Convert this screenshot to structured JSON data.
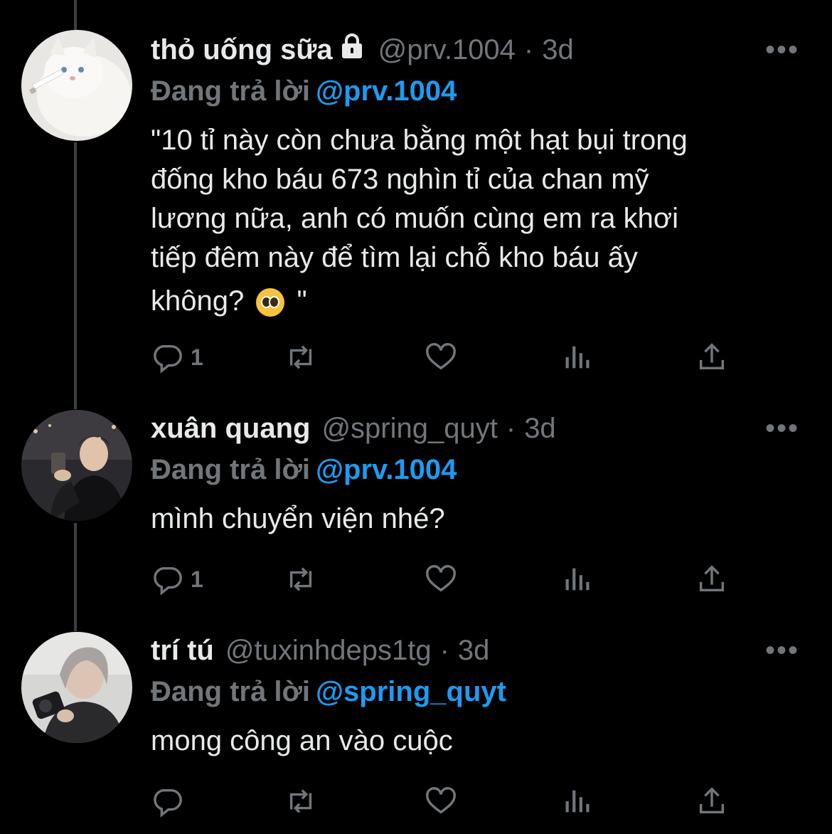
{
  "tweets": [
    {
      "name": "thỏ uống sữa",
      "handle": "@prv.1004",
      "dot": "·",
      "time": "3d",
      "more": "•••",
      "replying_label": "Đang trả lời",
      "replying_to": "@prv.1004",
      "text_lines": [
        "\"10 tỉ này còn chưa bằng một hạt bụi trong",
        "đống kho báu 673 nghìn tỉ của chan mỹ",
        "lương nữa, anh có muốn cùng em ra khơi",
        "tiếp đêm này để tìm lại chỗ kho báu ấy"
      ],
      "text_last_before": "không?",
      "text_last_after": "\"",
      "emoji": "pleading-face-emoji",
      "reply_count": "1"
    },
    {
      "name": "xuân quang",
      "handle": "@spring_quyt",
      "dot": "·",
      "time": "3d",
      "more": "•••",
      "replying_label": "Đang trả lời",
      "replying_to": "@prv.1004",
      "text": "mình chuyển viện nhé?",
      "reply_count": "1"
    },
    {
      "name": "trí tú",
      "handle": "@tuxinhdeps1tg",
      "dot": "·",
      "time": "3d",
      "more": "•••",
      "replying_label": "Đang trả lời",
      "replying_to": "@spring_quyt",
      "text": "mong công an vào cuộc",
      "reply_count": ""
    }
  ],
  "icons": {
    "reply": "reply-icon",
    "retweet": "retweet-icon",
    "like": "heart-icon",
    "views": "analytics-icon",
    "share": "share-icon",
    "lock": "lock-icon"
  },
  "colors": {
    "background": "#000000",
    "primary_text": "#e7e9ea",
    "secondary_text": "#71767b",
    "link": "#1d9bf0"
  }
}
